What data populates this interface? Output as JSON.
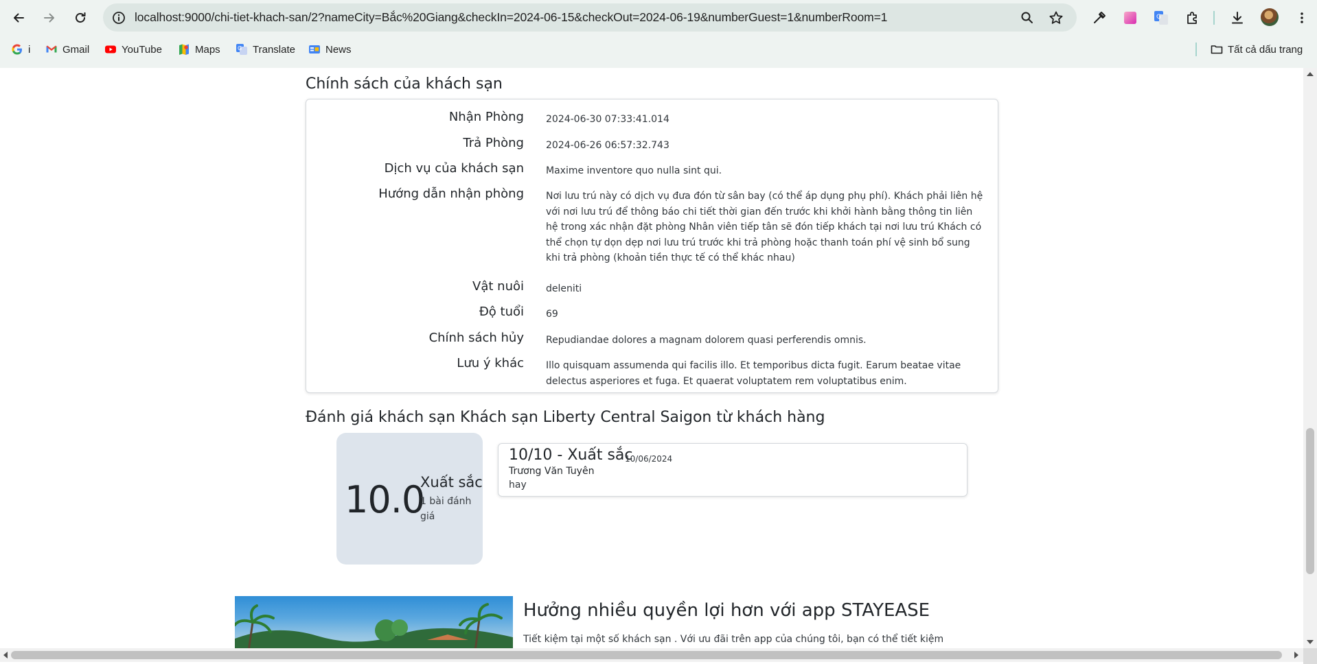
{
  "browser": {
    "url": "localhost:9000/chi-tiet-khach-san/2?nameCity=Bắc%20Giang&checkIn=2024-06-15&checkOut=2024-06-19&numberGuest=1&numberRoom=1",
    "bookmarks": [
      {
        "label": "i",
        "icon": "google-icon"
      },
      {
        "label": "Gmail",
        "icon": "gmail-icon"
      },
      {
        "label": "YouTube",
        "icon": "youtube-icon"
      },
      {
        "label": "Maps",
        "icon": "maps-icon"
      },
      {
        "label": "Translate",
        "icon": "translate-icon"
      },
      {
        "label": "News",
        "icon": "news-icon"
      }
    ],
    "all_bookmarks_label": "Tất cả dấu trang"
  },
  "policy": {
    "title": "Chính sách của khách sạn",
    "rows": [
      {
        "label": "Nhận Phòng",
        "value": "2024-06-30 07:33:41.014"
      },
      {
        "label": "Trả Phòng",
        "value": "2024-06-26 06:57:32.743"
      },
      {
        "label": "Dịch vụ của khách sạn",
        "value": "Maxime inventore quo nulla sint qui."
      },
      {
        "label": "Hướng dẫn nhận phòng",
        "value": "Nơi lưu trú này có dịch vụ đưa đón từ sân bay (có thể áp dụng phụ phí). Khách phải liên hệ với nơi lưu trú để thông báo chi tiết thời gian đến trước khi khởi hành bằng thông tin liên hệ trong xác nhận đặt phòng Nhân viên tiếp tân sẽ đón tiếp khách tại nơi lưu trú Khách có thể chọn tự dọn dẹp nơi lưu trú trước khi trả phòng hoặc thanh toán phí vệ sinh bổ sung khi trả phòng (khoản tiền thực tế có thể khác nhau)"
      },
      {
        "label": "Vật nuôi",
        "value": "deleniti"
      },
      {
        "label": "Độ tuổi",
        "value": "69"
      },
      {
        "label": "Chính sách hủy",
        "value": "Repudiandae dolores a magnam dolorem quasi perferendis omnis."
      },
      {
        "label": "Lưu ý khác",
        "value": "Illo quisquam assumenda qui facilis illo. Et temporibus dicta fugit. Earum beatae vitae delectus asperiores et fuga. Et quaerat voluptatem rem voluptatibus enim."
      }
    ]
  },
  "reviews": {
    "title": "Đánh giá khách sạn Khách sạn Liberty Central Saigon từ khách hàng",
    "summary": {
      "score": "10.0",
      "label": "Xuất sắc",
      "count": "1 bài đánh giá"
    },
    "items": [
      {
        "score": "10/10 - Xuất sắc",
        "date": "10/06/2024",
        "name": "Trương Văn Tuyên",
        "text": "hay"
      }
    ]
  },
  "promo": {
    "title": "Hưởng nhiều quyền lợi hơn với app STAYEASE",
    "text": "Tiết kiệm tại một số khách sạn . Với ưu đãi trên app của chúng tôi, bạn có thể tiết kiệm"
  }
}
